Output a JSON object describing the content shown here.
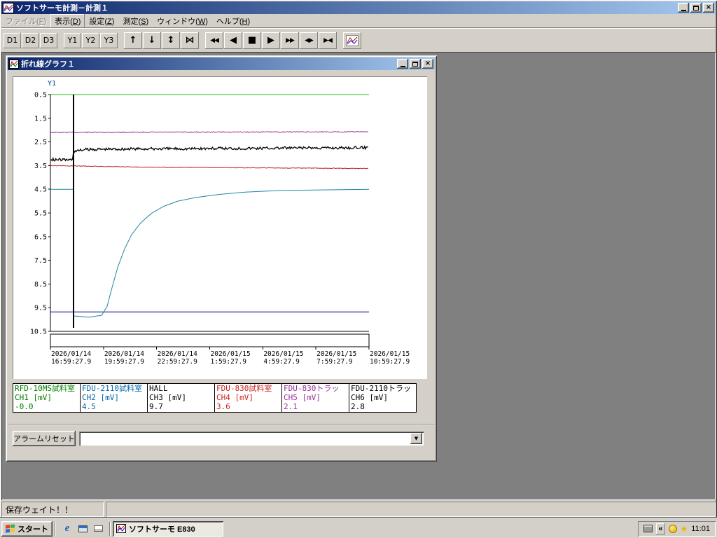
{
  "window": {
    "title": "ソフトサーモ計測－計測１"
  },
  "menu": {
    "items": [
      {
        "id": "file",
        "label": "ファイル(F)",
        "state": "disabled"
      },
      {
        "id": "view",
        "label": "表示(D)",
        "state": "raised"
      },
      {
        "id": "settings",
        "label": "設定(Z)",
        "state": "normal"
      },
      {
        "id": "measure",
        "label": "測定(S)",
        "state": "normal"
      },
      {
        "id": "window",
        "label": "ウィンドウ(W)",
        "state": "normal"
      },
      {
        "id": "help",
        "label": "ヘルプ(H)",
        "state": "normal"
      }
    ]
  },
  "toolbar": {
    "groups": [
      {
        "buttons": [
          {
            "label": "D1",
            "name": "d1-button"
          },
          {
            "label": "D2",
            "name": "d2-button"
          },
          {
            "label": "D3",
            "name": "d3-button"
          }
        ]
      },
      {
        "buttons": [
          {
            "label": "Y1",
            "name": "y1-button"
          },
          {
            "label": "Y2",
            "name": "y2-button"
          },
          {
            "label": "Y3",
            "name": "y3-button"
          }
        ]
      },
      {
        "buttons": [
          {
            "glyph": "↑",
            "name": "scale-up-button",
            "icon": "up-arrow-icon"
          },
          {
            "glyph": "↓",
            "name": "scale-down-button",
            "icon": "down-arrow-icon"
          },
          {
            "glyph": "↕",
            "name": "scale-expand-button",
            "icon": "up-down-arrow-icon"
          },
          {
            "glyph": "⋈",
            "name": "auto-scale-button",
            "icon": "hourglass-icon"
          }
        ]
      },
      {
        "buttons": [
          {
            "glyph": "◀◀",
            "name": "scroll-fast-left-button",
            "icon": "double-left-arrow-icon"
          },
          {
            "glyph": "◀",
            "name": "scroll-left-button",
            "icon": "left-arrow-icon"
          },
          {
            "glyph": "■",
            "name": "stop-scroll-button",
            "icon": "stop-icon"
          },
          {
            "glyph": "▶",
            "name": "scroll-right-button",
            "icon": "right-arrow-icon"
          },
          {
            "glyph": "▶▶",
            "name": "scroll-fast-right-button",
            "icon": "double-right-arrow-icon"
          },
          {
            "glyph": "◀▶",
            "name": "expand-time-axis-button",
            "icon": "expand-arrows-icon"
          },
          {
            "glyph": "▶◀",
            "name": "compress-time-axis-button",
            "icon": "compress-arrows-icon"
          }
        ]
      },
      {
        "buttons": [
          {
            "name": "line-graph-button",
            "icon": "line-graph-icon"
          }
        ]
      }
    ]
  },
  "graph_window": {
    "title": "折れ線グラフ１"
  },
  "legend": {
    "channels": [
      {
        "device": "RFD-10MS試料室",
        "channel": "CH1 [mV]",
        "value": "-0.0",
        "color": "#008000"
      },
      {
        "device": "FDU-2110試料室",
        "channel": "CH2 [mV]",
        "value": "4.5",
        "color": "#0066aa"
      },
      {
        "device": "HALL",
        "channel": "CH3 [mV]",
        "value": "9.7",
        "color": "#000000"
      },
      {
        "device": "FDU-830試料室",
        "channel": "CH4 [mV]",
        "value": "3.6",
        "color": "#cc2222"
      },
      {
        "device": "FDU-830トラッ",
        "channel": "CH5 [mV]",
        "value": "2.1",
        "color": "#993399"
      },
      {
        "device": "FDU-2110トラッ",
        "channel": "CH6 [mV]",
        "value": "2.8",
        "color": "#000000"
      }
    ]
  },
  "alarm": {
    "reset_label": "アラームリセット",
    "combo_value": ""
  },
  "statusbar": {
    "message": "保存ウェイト！！"
  },
  "taskbar": {
    "start_label": "スタート",
    "task_label": "ソフトサーモ  E830",
    "clock": "11:01"
  },
  "icons": {
    "dropdown": "▼",
    "tray_chevron": "«",
    "tray_star": "★",
    "close": "×"
  },
  "chart_data": {
    "type": "line",
    "title": "折れ線グラフ１",
    "y_axis": {
      "label": "Y1",
      "inverted": true,
      "ticks": [
        0.5,
        1.5,
        2.5,
        3.5,
        4.5,
        5.5,
        6.5,
        7.5,
        8.5,
        9.5,
        10.5
      ]
    },
    "x_axis": {
      "hours_span": 18,
      "tick_interval_hours": 3,
      "ticks": [
        {
          "date": "2026/01/14",
          "time": "16:59:27.9"
        },
        {
          "date": "2026/01/14",
          "time": "19:59:27.9"
        },
        {
          "date": "2026/01/14",
          "time": "22:59:27.9"
        },
        {
          "date": "2026/01/15",
          "time": "1:59:27.9"
        },
        {
          "date": "2026/01/15",
          "time": "4:59:27.9"
        },
        {
          "date": "2026/01/15",
          "time": "7:59:27.9"
        },
        {
          "date": "2026/01/15",
          "time": "10:59:27.9"
        }
      ]
    },
    "event_marker": {
      "x_hours": 1.3,
      "y_from": 0.5,
      "y_to": 10.35
    },
    "series": [
      {
        "name": "CH1",
        "color": "#22bb22",
        "noise": 0,
        "points": [
          [
            0,
            0.5
          ],
          [
            18,
            0.5
          ]
        ]
      },
      {
        "name": "CH5",
        "color": "#993399",
        "noise": 0.02,
        "points": [
          [
            0,
            2.1
          ],
          [
            18,
            2.07
          ]
        ]
      },
      {
        "name": "CH4",
        "color": "#bb2222",
        "noise": 0.012,
        "points": [
          [
            0,
            3.5
          ],
          [
            6,
            3.57
          ],
          [
            18,
            3.62
          ]
        ]
      },
      {
        "name": "CH3",
        "color": "#000080",
        "noise": 0,
        "points": [
          [
            0,
            9.68
          ],
          [
            18,
            9.68
          ]
        ]
      },
      {
        "name": "CH2",
        "color": "#2288a0",
        "noise": 0,
        "points": [
          [
            0,
            4.5
          ],
          [
            1.3,
            4.5
          ],
          [
            1.3,
            9.85
          ],
          [
            2.2,
            9.9
          ],
          [
            2.9,
            9.82
          ],
          [
            3.2,
            9.45
          ],
          [
            3.5,
            8.6
          ],
          [
            3.8,
            7.8
          ],
          [
            4.2,
            7.0
          ],
          [
            4.6,
            6.4
          ],
          [
            5.1,
            5.92
          ],
          [
            5.7,
            5.52
          ],
          [
            6.4,
            5.22
          ],
          [
            7.2,
            5.0
          ],
          [
            8.2,
            4.85
          ],
          [
            9.5,
            4.72
          ],
          [
            11,
            4.62
          ],
          [
            13,
            4.55
          ],
          [
            18,
            4.5
          ]
        ]
      },
      {
        "name": "CH6",
        "color": "#000000",
        "noise": 0.06,
        "width": 1.3,
        "points": [
          [
            0,
            3.25
          ],
          [
            1.3,
            3.25
          ],
          [
            1.3,
            2.9
          ],
          [
            2.0,
            2.82
          ],
          [
            3.5,
            2.8
          ],
          [
            18,
            2.74
          ]
        ]
      }
    ]
  }
}
